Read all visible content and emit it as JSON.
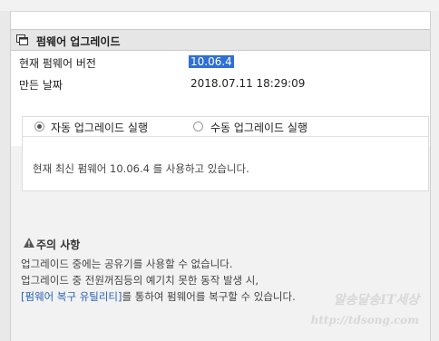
{
  "firmware_section": {
    "title": "펌웨어 업그레이드",
    "rows": [
      {
        "label": "현재 펌웨어 버전",
        "value": "10.06.4"
      },
      {
        "label": "만든 날짜",
        "value": "2018.07.11 18:29:09"
      }
    ]
  },
  "upgrade_mode": {
    "selected": "auto",
    "options": [
      {
        "id": "auto",
        "label": "자동 업그레이드 실행"
      },
      {
        "id": "manual",
        "label": "수동 업그레이드 실행"
      }
    ],
    "status": "현재 최신 펌웨어 10.06.4 를 사용하고 있습니다."
  },
  "notice": {
    "title": "주의 사항",
    "line1": "업그레이드 중에는 공유기를 사용할 수 없습니다.",
    "line2": "업그레이드 중 전원꺼짐등의 예기치 못한 동작 발생 시,",
    "line3_link": "[펌웨어 복구 유틸리티]",
    "line3_rest": "를 통하여 펌웨어를 복구할 수 있습니다."
  },
  "watermark": {
    "line1": "알송달송IT세상",
    "line2": "http://tdsong.com"
  },
  "colors": {
    "selection": "#2f6fd6",
    "link": "#2a64b4",
    "panel_bg": "#f2f2f2",
    "header_bg": "#e6e6e6"
  }
}
